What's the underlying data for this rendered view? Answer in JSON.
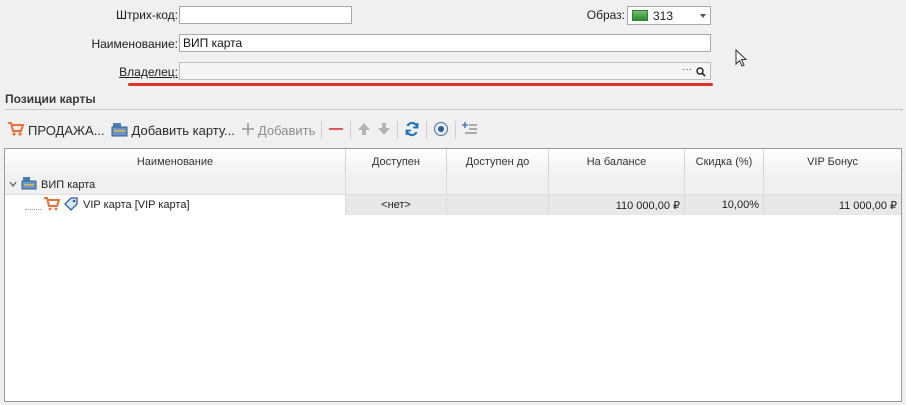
{
  "form": {
    "barcode_label": "Штрих-код:",
    "barcode_value": "",
    "image_label": "Образ:",
    "image_value": "313",
    "name_label": "Наименование:",
    "name_value": "ВИП карта",
    "owner_label": "Владелец:",
    "owner_value": "",
    "owner_ellipsis": "···"
  },
  "section": {
    "title": "Позиции карты"
  },
  "toolbar": {
    "sale_label": "ПРОДАЖА...",
    "add_card_label": "Добавить карту...",
    "add_label": "Добавить"
  },
  "grid": {
    "columns": [
      "Наименование",
      "Доступен",
      "Доступен до",
      "На балансе",
      "Скидка (%)",
      "VIP Бонус"
    ],
    "group": {
      "name": "ВИП карта"
    },
    "rows": [
      {
        "name": "VIP карта [VIP карта]",
        "available": "<нет>",
        "available_until": "",
        "balance": "110 000,00 ₽",
        "discount": "10,00%",
        "vip_bonus": "11 000,00 ₽"
      }
    ]
  },
  "colors": {
    "accent_red": "#e03131",
    "cart_orange": "#e8703a",
    "refresh_blue": "#1f6fbf"
  },
  "icons": [
    "cart-icon",
    "card-stack-icon",
    "plus-icon",
    "minus-icon",
    "arrow-up-icon",
    "arrow-down-icon",
    "refresh-icon",
    "eye-icon",
    "list-plus-icon",
    "search-icon",
    "chevron-down-icon",
    "tag-icon",
    "expand-arrow-icon"
  ]
}
